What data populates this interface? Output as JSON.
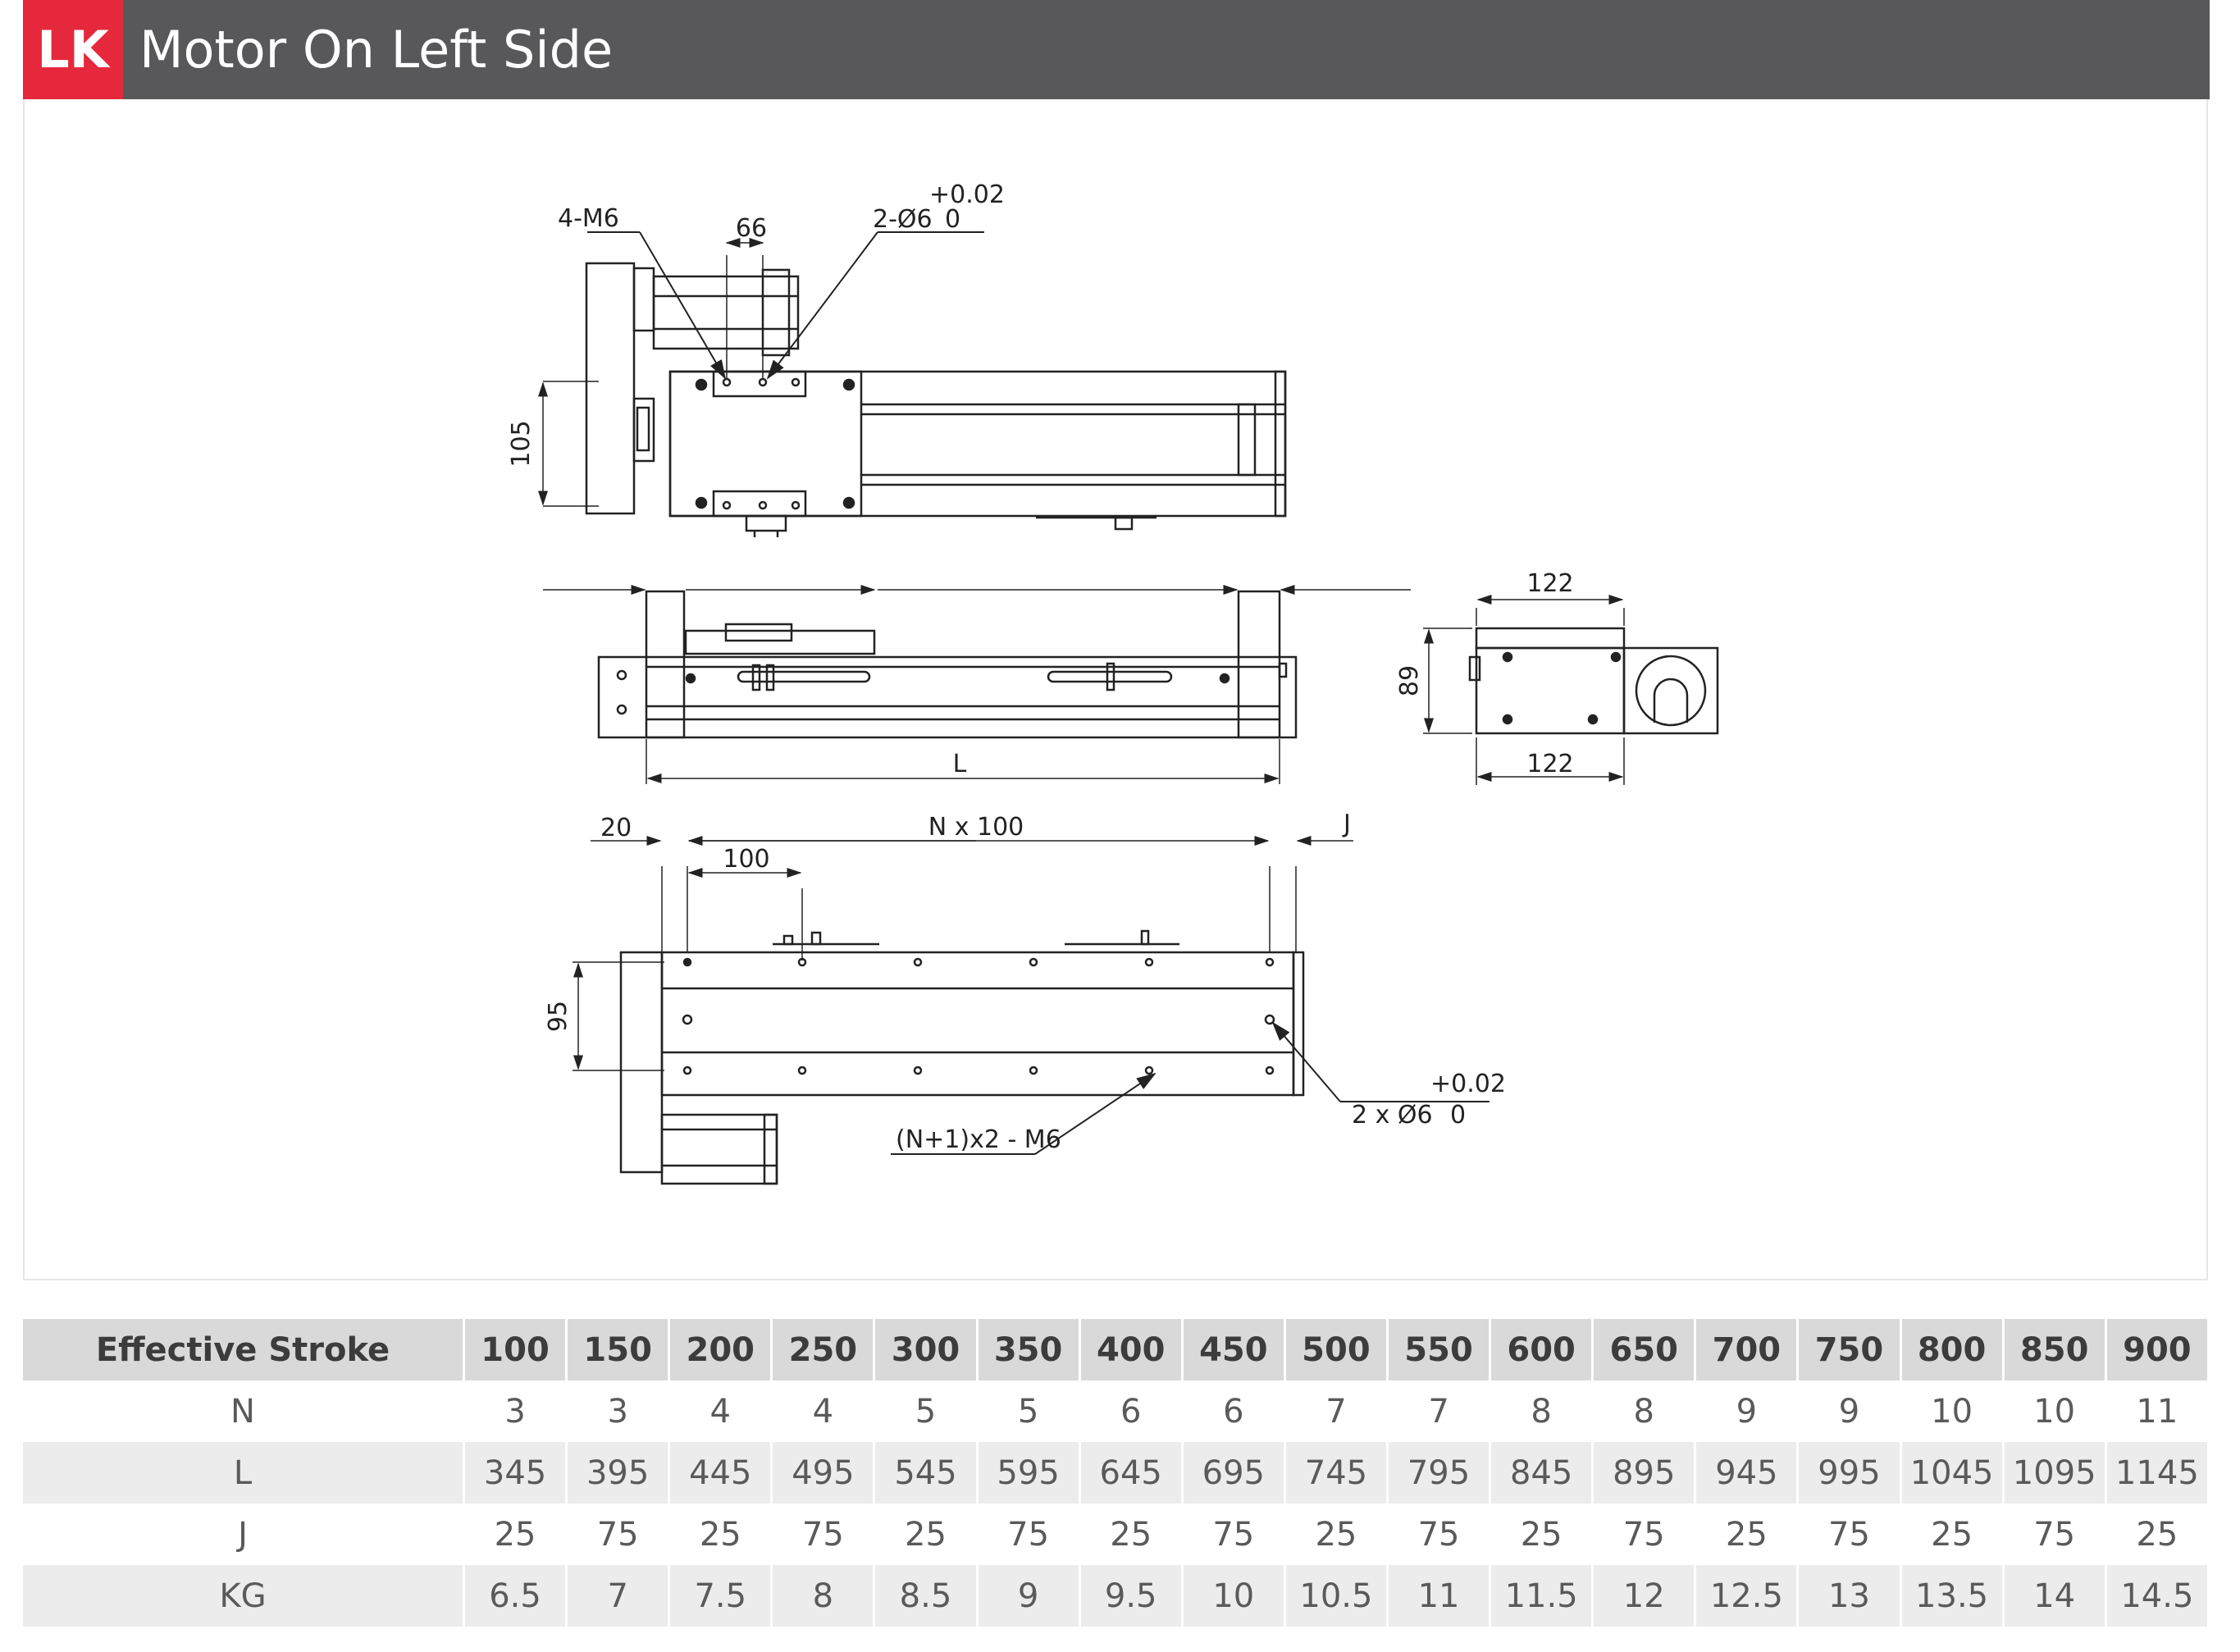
{
  "header": {
    "badge": "LK",
    "title": "Motor On Left Side"
  },
  "drawing": {
    "top_view": {
      "label_4m6": "4-M6",
      "dim_66": "66",
      "tol_top": "+0.02",
      "label_pin": "2-Ø6",
      "tol_bottom": "0",
      "dim_105": "105"
    },
    "side_view": {
      "dim_L": "L"
    },
    "end_view": {
      "dim_122_top": "122",
      "dim_122_bottom": "122",
      "dim_89": "89"
    },
    "bottom_view": {
      "dim_20": "20",
      "dim_n100": "N x 100",
      "dim_j": "J",
      "dim_100": "100",
      "dim_95": "95",
      "label_holes": "(N+1)x2 - M6",
      "tol_top": "+0.02",
      "label_pin": "2 x Ø6",
      "tol_bottom": "0"
    }
  },
  "table": {
    "header_label": "Effective Stroke",
    "strokes": [
      "100",
      "150",
      "200",
      "250",
      "300",
      "350",
      "400",
      "450",
      "500",
      "550",
      "600",
      "650",
      "700",
      "750",
      "800",
      "850",
      "900"
    ],
    "rows": [
      {
        "label": "N",
        "values": [
          "3",
          "3",
          "4",
          "4",
          "5",
          "5",
          "6",
          "6",
          "7",
          "7",
          "8",
          "8",
          "9",
          "9",
          "10",
          "10",
          "11"
        ]
      },
      {
        "label": "L",
        "values": [
          "345",
          "395",
          "445",
          "495",
          "545",
          "595",
          "645",
          "695",
          "745",
          "795",
          "845",
          "895",
          "945",
          "995",
          "1045",
          "1095",
          "1145"
        ]
      },
      {
        "label": "J",
        "values": [
          "25",
          "75",
          "25",
          "75",
          "25",
          "75",
          "25",
          "75",
          "25",
          "75",
          "25",
          "75",
          "25",
          "75",
          "25",
          "75",
          "25"
        ]
      },
      {
        "label": "KG",
        "values": [
          "6.5",
          "7",
          "7.5",
          "8",
          "8.5",
          "9",
          "9.5",
          "10",
          "10.5",
          "11",
          "11.5",
          "12",
          "12.5",
          "13",
          "13.5",
          "14",
          "14.5"
        ]
      }
    ]
  }
}
